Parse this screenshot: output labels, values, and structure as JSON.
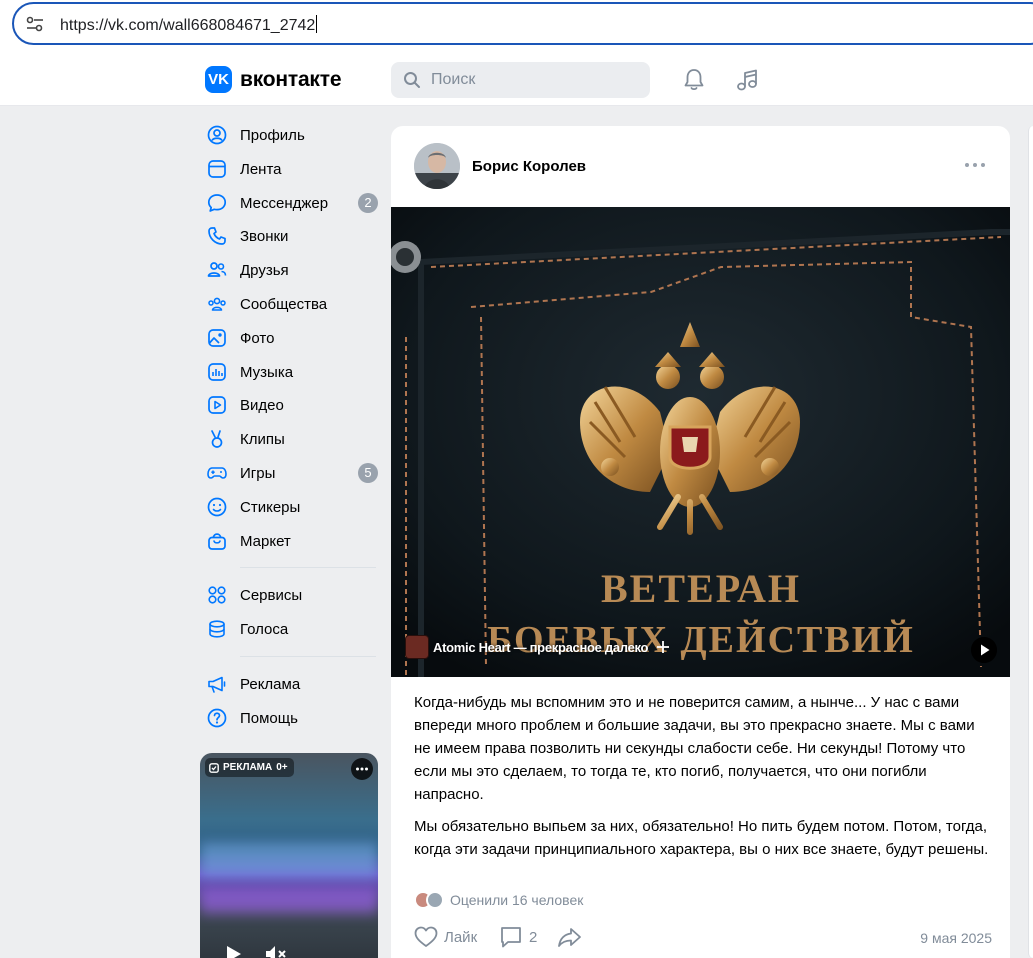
{
  "browser": {
    "url": "https://vk.com/wall668084671_2742"
  },
  "header": {
    "logo_mark": "VK",
    "logo_text": "вконтакте",
    "search_placeholder": "Поиск",
    "icons": [
      "bell-icon",
      "music-note-icon"
    ]
  },
  "sidebar": {
    "items": [
      {
        "label": "Профиль",
        "icon": "profile-icon"
      },
      {
        "label": "Лента",
        "icon": "feed-icon"
      },
      {
        "label": "Мессенджер",
        "icon": "messenger-icon",
        "badge": "2"
      },
      {
        "label": "Звонки",
        "icon": "phone-icon"
      },
      {
        "label": "Друзья",
        "icon": "friends-icon"
      },
      {
        "label": "Сообщества",
        "icon": "communities-icon"
      },
      {
        "label": "Фото",
        "icon": "photo-icon"
      },
      {
        "label": "Музыка",
        "icon": "music-icon"
      },
      {
        "label": "Видео",
        "icon": "video-icon"
      },
      {
        "label": "Клипы",
        "icon": "clips-icon"
      },
      {
        "label": "Игры",
        "icon": "games-icon",
        "badge": "5"
      },
      {
        "label": "Стикеры",
        "icon": "stickers-icon"
      },
      {
        "label": "Маркет",
        "icon": "market-icon"
      }
    ],
    "items2": [
      {
        "label": "Сервисы",
        "icon": "services-icon"
      },
      {
        "label": "Голоса",
        "icon": "votes-icon"
      }
    ],
    "items3": [
      {
        "label": "Реклама",
        "icon": "megaphone-icon"
      },
      {
        "label": "Помощь",
        "icon": "help-icon"
      }
    ],
    "ad": {
      "label": "РЕКЛАМА",
      "age": "0+"
    }
  },
  "post": {
    "author": "Борис Королев",
    "image_caption": "ВЕТЕРАН БОЕВЫХ ДЕЙСТВИЙ",
    "track_title": "Atomic Heart — прекрасное далеко",
    "paragraphs": [
      "Когда-нибудь мы вспомним это и не поверится самим, а нынче... У нас с вами впереди много проблем и большие задачи, вы это прекрасно знаете. Мы с вами не имеем права позволить ни секунды слабости себе. Ни секунды! Потому что если мы это сделаем, то тогда те, кто погиб, получается, что они погибли напрасно.",
      "Мы обязательно выпьем за них, обязательно! Но пить будем потом. Потом, тогда, когда эти задачи принципиального характера, вы о них все знаете, будут решены."
    ],
    "liked_text": "Оценили 16 человек",
    "like_label": "Лайк",
    "comments_count": "2",
    "date": "9 мая 2025"
  },
  "colors": {
    "accent": "#0077ff",
    "background": "#edeef0",
    "secondary_text": "#818c99",
    "badge": "#99a2ad"
  }
}
